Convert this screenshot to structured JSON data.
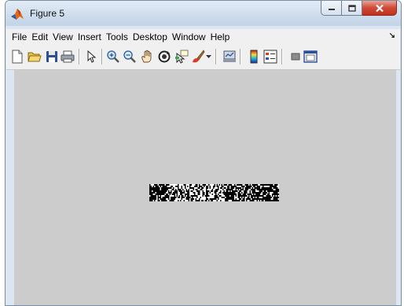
{
  "window": {
    "title": "Figure 5",
    "icon": "matlab-logo-icon"
  },
  "window_controls": {
    "minimize": "minimize-icon",
    "maximize": "maximize-icon",
    "close": "close-icon"
  },
  "menu": {
    "items": [
      "File",
      "Edit",
      "View",
      "Insert",
      "Tools",
      "Desktop",
      "Window",
      "Help"
    ],
    "dock_glyph": "↘"
  },
  "toolbar": {
    "buttons": [
      "new-figure-icon",
      "open-file-icon",
      "save-figure-icon",
      "print-figure-icon",
      "edit-plot-icon",
      "zoom-in-icon",
      "zoom-out-icon",
      "pan-icon",
      "rotate-3d-icon",
      "data-cursor-icon",
      "brush-icon",
      "link-plot-icon",
      "insert-colorbar-icon",
      "insert-legend-icon",
      "hide-plot-tools-icon",
      "show-plot-tools-icon"
    ]
  },
  "colors": {
    "canvas": "#cccccc",
    "titlebar": "#cddcec",
    "close_button": "#c9402c",
    "toolbar": "#f0f0f0"
  }
}
